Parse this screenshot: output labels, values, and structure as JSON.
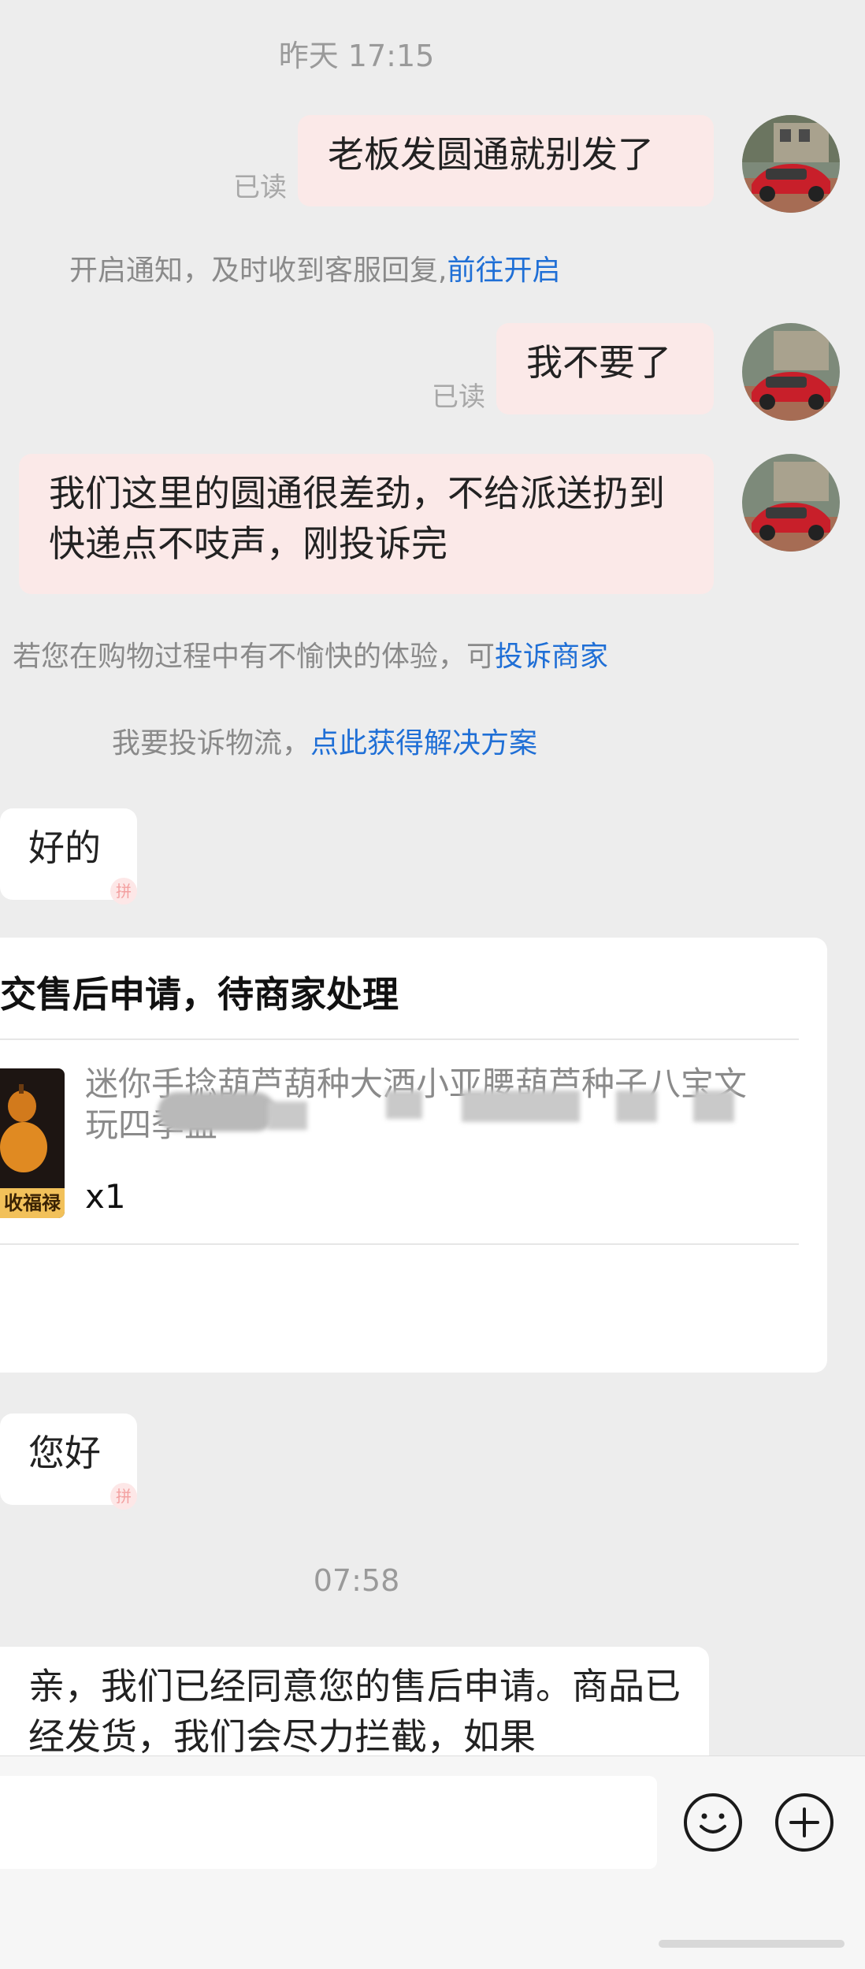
{
  "timestamps": {
    "yesterday": "昨天 17:15",
    "today": "07:58"
  },
  "messages": {
    "out1": "老板发圆通就别发了",
    "out2": "我不要了",
    "out3": "我们这里的圆通很差劲，不给派送扔到快递点不吱声，刚投诉完",
    "in1": "好的",
    "in2": "您好",
    "in3": "亲，我们已经同意您的售后申请。商品已经发货，我们会尽力拦截，如果"
  },
  "read_label": "已读",
  "system": {
    "notify_text": "开启通知，及时收到客服回复,",
    "notify_link": "前往开启",
    "complain_text": "若您在购物过程中有不愉快的体验，可",
    "complain_link": "投诉商家",
    "logistics_text": "我要投诉物流，",
    "logistics_link": "点此获得解决方案"
  },
  "card": {
    "title": "交售后申请，待商家处理",
    "product_line1": "迷你手捻葫芦葫种大酒小亚腰葫芦种子八宝文",
    "product_line2": "玩四季盘",
    "thumb_label": "收福禄",
    "quantity": "x1"
  },
  "icons": {
    "emoji": "smiley-icon",
    "plus": "plus-icon"
  },
  "colors": {
    "background": "#ededed",
    "outgoing_bubble": "#fbe9e8",
    "incoming_bubble": "#ffffff",
    "link": "#1f6fd6"
  }
}
